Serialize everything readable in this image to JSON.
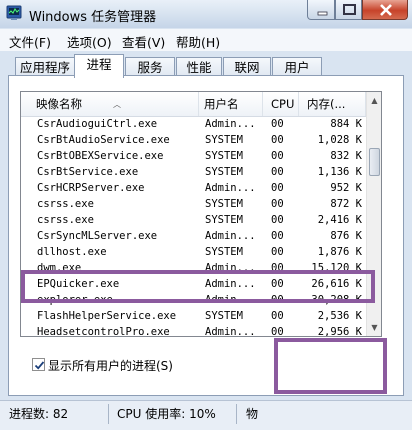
{
  "window": {
    "title": "Windows 任务管理器"
  },
  "menu": [
    "文件(F)",
    "选项(O)",
    "查看(V)",
    "帮助(H)"
  ],
  "tabs": [
    "应用程序",
    "进程",
    "服务",
    "性能",
    "联网",
    "用户"
  ],
  "active_tab": "进程",
  "columns": {
    "name": "映像名称",
    "user": "用户名",
    "cpu": "CPU",
    "mem": "内存(..."
  },
  "rows": [
    {
      "name": "CsrAudioguiCtrl.exe",
      "user": "Admin...",
      "cpu": "00",
      "mem": "884 K"
    },
    {
      "name": "CsrBtAudioService.exe",
      "user": "SYSTEM",
      "cpu": "00",
      "mem": "1,028 K"
    },
    {
      "name": "CsrBtOBEXService.exe",
      "user": "SYSTEM",
      "cpu": "00",
      "mem": "832 K"
    },
    {
      "name": "CsrBtService.exe",
      "user": "SYSTEM",
      "cpu": "00",
      "mem": "1,136 K"
    },
    {
      "name": "CsrHCRPServer.exe",
      "user": "Admin...",
      "cpu": "00",
      "mem": "952 K"
    },
    {
      "name": "csrss.exe",
      "user": "SYSTEM",
      "cpu": "00",
      "mem": "872 K"
    },
    {
      "name": "csrss.exe",
      "user": "SYSTEM",
      "cpu": "00",
      "mem": "2,416 K"
    },
    {
      "name": "CsrSyncMLServer.exe",
      "user": "Admin...",
      "cpu": "00",
      "mem": "876 K"
    },
    {
      "name": "dllhost.exe",
      "user": "SYSTEM",
      "cpu": "00",
      "mem": "1,876 K"
    },
    {
      "name": "dwm.exe",
      "user": "Admin...",
      "cpu": "00",
      "mem": "15,120 K"
    },
    {
      "name": "EPQuicker.exe",
      "user": "Admin...",
      "cpu": "00",
      "mem": "26,616 K"
    },
    {
      "name": "explorer.exe",
      "user": "Admin...",
      "cpu": "00",
      "mem": "30,208 K"
    },
    {
      "name": "FlashHelperService.exe",
      "user": "SYSTEM",
      "cpu": "00",
      "mem": "2,536 K"
    },
    {
      "name": "HeadsetcontrolPro.exe",
      "user": "Admin...",
      "cpu": "00",
      "mem": "2,956 K"
    }
  ],
  "show_all_users": {
    "label": "显示所有用户的进程(S)",
    "checked": true
  },
  "status": {
    "processes": "进程数: 82",
    "cpu": "CPU 使用率: 10%",
    "mem": "物"
  }
}
